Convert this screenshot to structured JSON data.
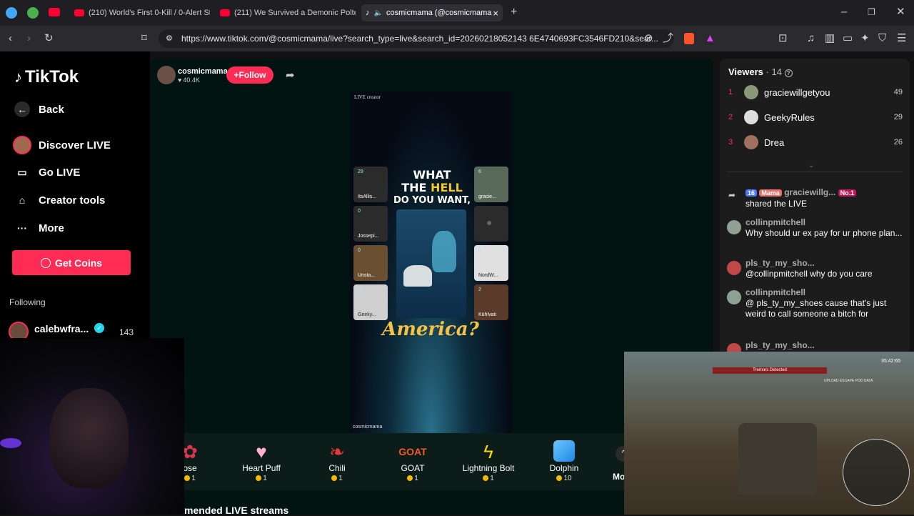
{
  "tabs": [
    {
      "label": "(210) World's First 0-Kill / 0-Alert Ste"
    },
    {
      "label": "(211) We Survived a Demonic Polterg"
    },
    {
      "label": "cosmicmama (@cosmicmama"
    }
  ],
  "address": {
    "url": "https://www.tiktok.com/@cosmicmama/live?search_type=live&search_id=20260218052143 6E4740693FC3546FD210&sear..."
  },
  "sidebar": {
    "logo": "TikTok",
    "items": [
      {
        "label": "Back"
      },
      {
        "label": "Discover LIVE"
      },
      {
        "label": "Go LIVE"
      },
      {
        "label": "Creator tools"
      },
      {
        "label": "More"
      }
    ],
    "get_coins": "Get Coins",
    "following_heading": "Following",
    "following": [
      {
        "name": "calebwfra...",
        "count": "143"
      }
    ]
  },
  "host": {
    "name": "cosmicmama",
    "likes": "40.4K",
    "follow": "+Follow"
  },
  "stream": {
    "label_top": "LIVE creator",
    "caption_top": [
      "WHAT",
      "THE",
      "HELL",
      "DO YOU WANT,"
    ],
    "caption_bottom": "America?",
    "watermark": "cosmicmama",
    "slots_left": [
      {
        "count": "29",
        "name": "ItsAllis..."
      },
      {
        "count": "0",
        "name": "Jossepi..."
      },
      {
        "count": "0",
        "name": "Unsta..."
      },
      {
        "count": "0",
        "name": "Geeky..."
      }
    ],
    "slots_right": [
      {
        "count": "6",
        "name": "gracie..."
      },
      {
        "count": "",
        "name": ""
      },
      {
        "count": "2",
        "name": "NordW..."
      },
      {
        "count": "2",
        "name": "Kühlvati"
      }
    ]
  },
  "gifts": [
    {
      "name": "ose",
      "price": "1",
      "icon": "🌹"
    },
    {
      "name": "Heart Puff",
      "price": "1",
      "icon": "☁"
    },
    {
      "name": "Chili",
      "price": "1",
      "icon": "🌶"
    },
    {
      "name": "GOAT",
      "price": "1",
      "icon": "GOAT"
    },
    {
      "name": "Lightning Bolt",
      "price": "1",
      "icon": "⚡"
    },
    {
      "name": "Dolphin",
      "price": "10",
      "icon": "🐬"
    }
  ],
  "gifts_more": "Mo",
  "recommended_heading": "mended LIVE streams",
  "viewers": {
    "title": "Viewers",
    "count": "· 14",
    "list": [
      {
        "rank": "1",
        "name": "graciewillgetyou",
        "score": "49"
      },
      {
        "rank": "2",
        "name": "GeekyRules",
        "score": "29"
      },
      {
        "rank": "3",
        "name": "Drea",
        "score": "26"
      }
    ]
  },
  "chat": [
    {
      "user": "graciewillg...",
      "badge1": "16",
      "badge2": "Mama",
      "badge3": "No.1",
      "text": "shared the LIVE"
    },
    {
      "user": "collinpmitchell",
      "text": "Why should ur ex pay for ur phone plan..."
    },
    {
      "user": "pls_ty_my_sho...",
      "text": "@collinpmitchell why do you care"
    },
    {
      "user": "collinpmitchell",
      "text": "@ pls_ty_my_shoes cause that's just weird to call someone a bitch for"
    },
    {
      "user": "pls_ty_my_sho...",
      "text": ""
    }
  ],
  "game_hud": {
    "time": "35:42:65",
    "alert": "Tremors Detected",
    "objective": "UPLOAD ESCAPE POD DATA"
  }
}
